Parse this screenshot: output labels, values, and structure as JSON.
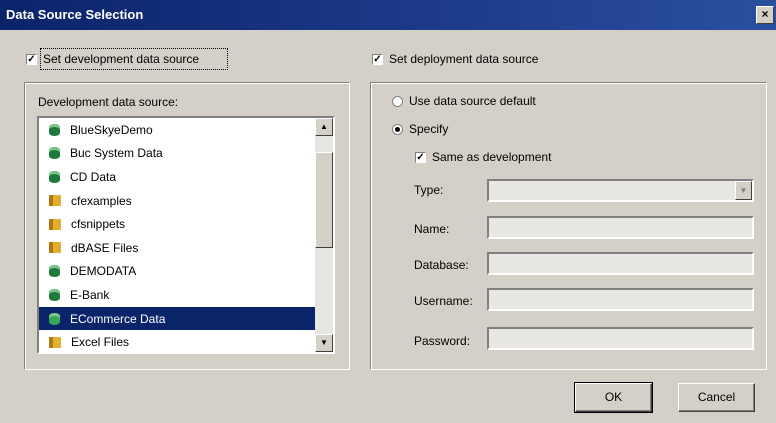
{
  "window": {
    "title": "Data Source Selection",
    "close_glyph": "×"
  },
  "development": {
    "checkbox_label": "Set development data source",
    "checked": true,
    "list_label": "Development data source:",
    "items": [
      {
        "label": "BlueSkyeDemo",
        "icon": "database-icon"
      },
      {
        "label": "Buc System Data",
        "icon": "database-icon"
      },
      {
        "label": "CD Data",
        "icon": "database-icon"
      },
      {
        "label": "cfexamples",
        "icon": "folder-icon"
      },
      {
        "label": "cfsnippets",
        "icon": "folder-icon"
      },
      {
        "label": "dBASE Files",
        "icon": "folder-icon"
      },
      {
        "label": "DEMODATA",
        "icon": "database-icon"
      },
      {
        "label": "E-Bank",
        "icon": "database-icon"
      },
      {
        "label": "ECommerce Data",
        "icon": "database-icon",
        "selected": true
      },
      {
        "label": "Excel Files",
        "icon": "folder-icon"
      }
    ]
  },
  "deployment": {
    "checkbox_label": "Set deployment data source",
    "checked": true,
    "radio_default_label": "Use data source default",
    "radio_specify_label": "Specify",
    "specify_selected": true,
    "same_as_dev_label": "Same as development",
    "same_as_dev_checked": true,
    "fields": {
      "type_label": "Type:",
      "name_label": "Name:",
      "database_label": "Database:",
      "username_label": "Username:",
      "password_label": "Password:"
    }
  },
  "buttons": {
    "ok": "OK",
    "cancel": "Cancel"
  }
}
